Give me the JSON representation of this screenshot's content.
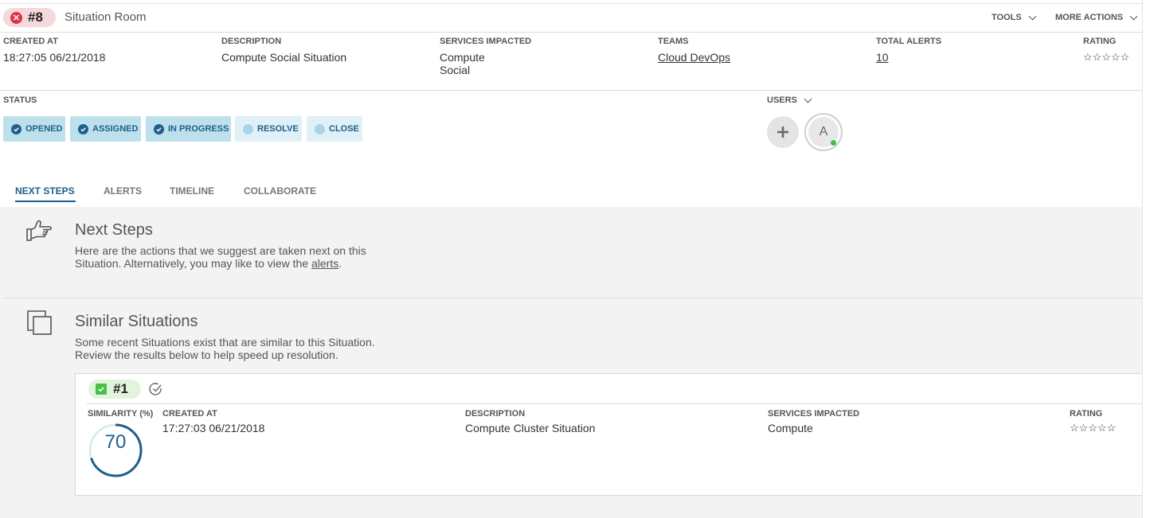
{
  "header": {
    "id": "#8",
    "title": "Situation Room",
    "tools_label": "TOOLS",
    "more_actions_label": "MORE ACTIONS"
  },
  "details": {
    "created_at_label": "CREATED AT",
    "created_at": "18:27:05 06/21/2018",
    "description_label": "DESCRIPTION",
    "description": "Compute Social Situation",
    "services_label": "SERVICES IMPACTED",
    "services": [
      "Compute",
      "Social"
    ],
    "teams_label": "TEAMS",
    "teams": "Cloud DevOps",
    "total_alerts_label": "TOTAL ALERTS",
    "total_alerts": "10",
    "rating_label": "RATING",
    "rating": "☆☆☆☆☆"
  },
  "status": {
    "label": "STATUS",
    "steps": [
      {
        "label": "OPENED",
        "done": true
      },
      {
        "label": "ASSIGNED",
        "done": true
      },
      {
        "label": "IN PROGRESS",
        "done": true
      },
      {
        "label": "RESOLVE",
        "done": false
      },
      {
        "label": "CLOSE",
        "done": false
      }
    ]
  },
  "users": {
    "label": "USERS",
    "avatar_initial": "A"
  },
  "tabs": [
    {
      "label": "NEXT STEPS",
      "active": true
    },
    {
      "label": "ALERTS",
      "active": false
    },
    {
      "label": "TIMELINE",
      "active": false
    },
    {
      "label": "COLLABORATE",
      "active": false
    }
  ],
  "next_steps": {
    "title": "Next Steps",
    "text_line1": "Here are the actions that we suggest are taken next on this",
    "text_line2_prefix": "Situation. Alternatively, you may like to view the ",
    "text_line2_link": "alerts",
    "text_line2_suffix": "."
  },
  "similar": {
    "title": "Similar Situations",
    "text_line1": "Some recent Situations exist that are similar to this Situation.",
    "text_line2": "Review the results below to help speed up resolution.",
    "items": [
      {
        "id": "#1",
        "similarity_label": "SIMILARITY (%)",
        "similarity": 70,
        "created_at_label": "CREATED AT",
        "created_at": "17:27:03 06/21/2018",
        "description_label": "DESCRIPTION",
        "description": "Compute Cluster Situation",
        "services_label": "SERVICES IMPACTED",
        "services": "Compute",
        "rating_label": "RATING",
        "rating": "☆☆☆☆☆"
      }
    ]
  },
  "colors": {
    "accent": "#1d5f8a",
    "critical": "#dc3545",
    "status_done": "#bde0ec",
    "status_todo": "#dff1f7",
    "online": "#3fbf3f"
  }
}
